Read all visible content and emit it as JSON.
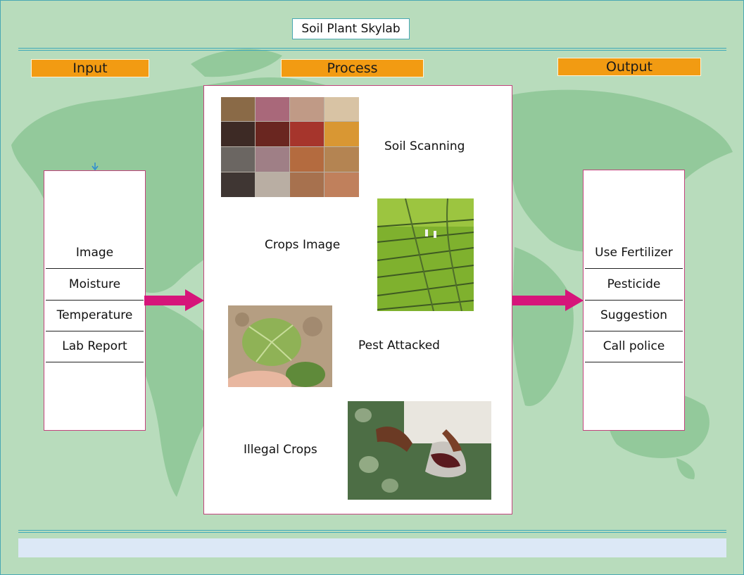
{
  "title": "Soil Plant Skylab",
  "headers": {
    "input": "Input",
    "process": "Process",
    "output": "Output"
  },
  "input_items": [
    "Image",
    "Moisture",
    "Temperature",
    "Lab Report"
  ],
  "process_items": {
    "soil_scanning": "Soil Scanning",
    "crops_image": "Crops Image",
    "pest_attacked": "Pest Attacked",
    "illegal_crops": "Illegal Crops"
  },
  "output_items": [
    "Use Fertilizer",
    "Pesticide",
    "Suggestion",
    "Call police"
  ],
  "colors": {
    "background": "#b8dcbc",
    "header": "#f29b12",
    "arrow": "#d6157a",
    "panel_border": "#c2447d",
    "rule": "#3fa9b9"
  }
}
